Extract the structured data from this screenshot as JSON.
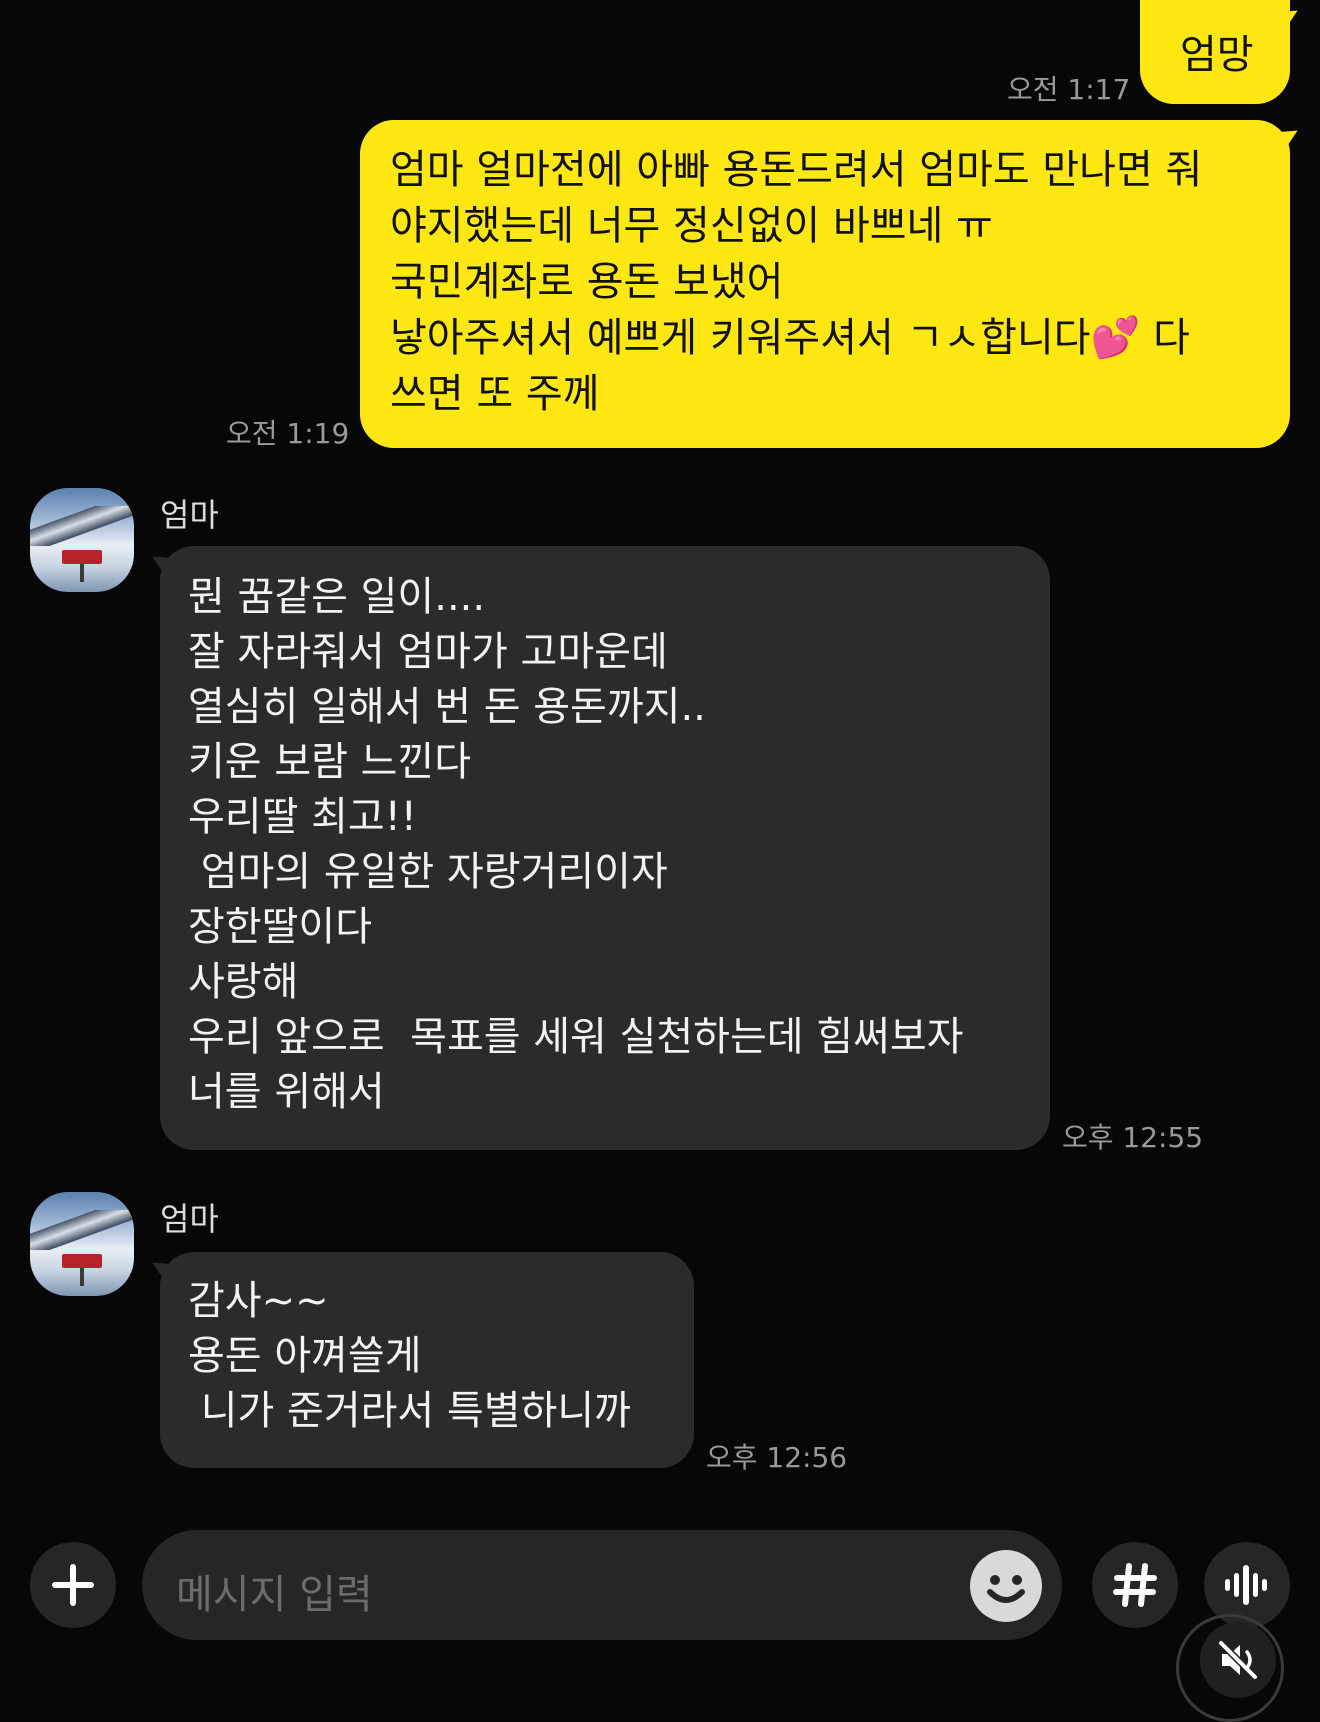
{
  "messages": [
    {
      "id": "m1",
      "direction": "outgoing",
      "text": "엄망",
      "time": "오전 1:17"
    },
    {
      "id": "m2",
      "direction": "outgoing",
      "text": "엄마 얼마전에 아빠 용돈드려서 엄마도 만나면 줘\n야지했는데 너무 정신없이 바쁘네 ㅠ\n국민계좌로 용돈 보냈어\n낳아주셔서 예쁘게 키워주셔서 ㄱㅅ합니다💕 다\n쓰면 또 주께",
      "time": "오전 1:19"
    },
    {
      "id": "m3",
      "direction": "incoming",
      "sender": "엄마",
      "text": "뭔 꿈같은 일이....\n잘 자라줘서 엄마가 고마운데\n열심히 일해서 번 돈 용돈까지..\n키운 보람 느낀다\n우리딸 최고!!\n 엄마의 유일한 자랑거리이자\n장한딸이다\n사랑해\n우리 앞으로  목표를 세워 실천하는데 힘써보자\n너를 위해서",
      "time": "오후 12:55"
    },
    {
      "id": "m4",
      "direction": "incoming",
      "sender": "엄마",
      "text": "감사~~\n용돈 아껴쓸게\n 니가 준거라서 특별하니까",
      "time": "오후 12:56"
    }
  ],
  "input": {
    "placeholder": "메시지 입력"
  },
  "icons": {
    "attach": "plus-icon",
    "emoji": "emoji-icon",
    "hashtag": "hashtag-icon",
    "voice": "voice-wave-icon",
    "mute": "muted-speaker-icon"
  },
  "colors": {
    "background": "#070707",
    "outgoing_bubble": "#ffe812",
    "incoming_bubble": "#2b2b2b",
    "timestamp": "#9a9a9a"
  }
}
